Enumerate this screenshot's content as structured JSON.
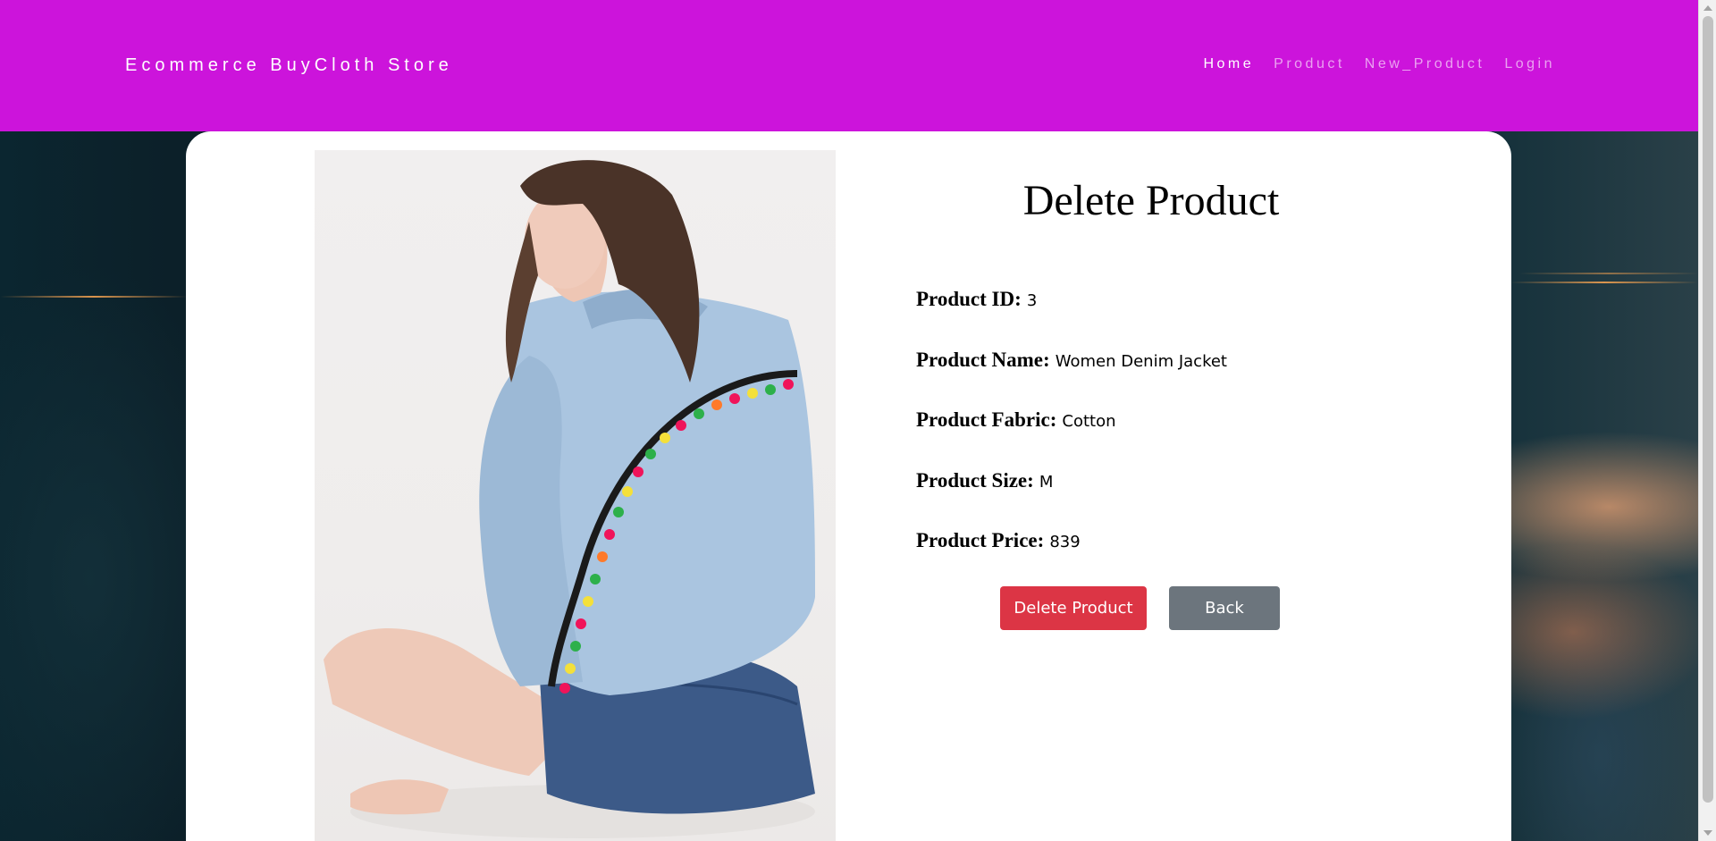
{
  "navbar": {
    "brand": "Ecommerce BuyCloth Store",
    "links": [
      {
        "label": "Home",
        "active": true
      },
      {
        "label": "Product",
        "active": false
      },
      {
        "label": "New_Product",
        "active": false
      },
      {
        "label": "Login",
        "active": false
      }
    ],
    "bg_color": "#cc14db"
  },
  "page": {
    "title": "Delete Product",
    "details": [
      {
        "label": "Product ID:",
        "value": "3"
      },
      {
        "label": "Product Name:",
        "value": "Women Denim Jacket"
      },
      {
        "label": "Product Fabric:",
        "value": "Cotton"
      },
      {
        "label": "Product Size:",
        "value": "M"
      },
      {
        "label": "Product Price:",
        "value": "839"
      }
    ],
    "buttons": {
      "delete_label": "Delete Product",
      "back_label": "Back"
    },
    "colors": {
      "danger": "#dc3545",
      "secondary": "#6c757d"
    }
  }
}
